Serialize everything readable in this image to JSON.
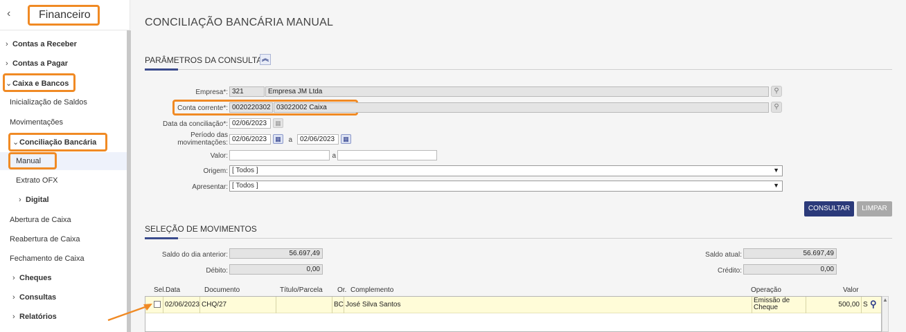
{
  "app": {
    "title": "Financeiro",
    "back_icon": "chevron-left-icon"
  },
  "sidebar": {
    "items": [
      {
        "label": "Contas a Receber"
      },
      {
        "label": "Contas a Pagar"
      },
      {
        "label": "Caixa e Bancos"
      },
      {
        "label": "Inicialização de Saldos"
      },
      {
        "label": "Movimentações"
      },
      {
        "label": "Conciliação Bancária"
      },
      {
        "label": "Manual"
      },
      {
        "label": "Extrato OFX"
      },
      {
        "label": "Digital"
      },
      {
        "label": "Abertura de Caixa"
      },
      {
        "label": "Reabertura de Caixa"
      },
      {
        "label": "Fechamento de Caixa"
      },
      {
        "label": "Cheques"
      },
      {
        "label": "Consultas"
      },
      {
        "label": "Relatórios"
      }
    ]
  },
  "page": {
    "title": "CONCILIAÇÃO BANCÁRIA MANUAL"
  },
  "params": {
    "section_title": "PARÂMETROS DA CONSULTA",
    "empresa_label": "Empresa*:",
    "empresa_code": "321",
    "empresa_name": "Empresa JM Ltda",
    "conta_label": "Conta corrente*:",
    "conta_code": "0020220302",
    "conta_name": "03022002 Caixa",
    "data_label": "Data da conciliação*:",
    "data_value": "02/06/2023",
    "periodo_label_1": "Período das",
    "periodo_label_2": "movimentações:",
    "periodo_from": "02/06/2023",
    "periodo_sep": "a",
    "periodo_to": "02/06/2023",
    "valor_label": "Valor:",
    "valor_from": "",
    "valor_sep": "a",
    "valor_to": "",
    "origem_label": "Origem:",
    "origem_value": "[ Todos ]",
    "apresentar_label": "Apresentar:",
    "apresentar_value": "[ Todos ]",
    "consultar_label": "CONSULTAR",
    "limpar_label": "LIMPAR"
  },
  "selecao": {
    "section_title": "SELEÇÃO DE MOVIMENTOS",
    "saldo_anterior_label": "Saldo do dia anterior:",
    "saldo_anterior_value": "56.697,49",
    "debito_label": "Débito:",
    "debito_value": "0,00",
    "saldo_atual_label": "Saldo atual:",
    "saldo_atual_value": "56.697,49",
    "credito_label": "Crédito:",
    "credito_value": "0,00"
  },
  "grid": {
    "headers": {
      "sel": "Sel.",
      "data": "Data",
      "documento": "Documento",
      "titulo": "Título/Parcela",
      "origem": "Or.",
      "complemento": "Complemento",
      "operacao": "Operação",
      "valor": "Valor"
    },
    "rows": [
      {
        "data": "02/06/2023",
        "documento": "CHQ/27",
        "titulo": "",
        "origem": "BC",
        "complemento": "José Silva Santos",
        "operacao_1": "Emissão de",
        "operacao_2": "Cheque",
        "valor": "500,00",
        "tipo": "S"
      }
    ]
  },
  "colors": {
    "highlight": "#f08a24",
    "primary_button": "#2b3a7a",
    "disabled_button": "#a9a9a9",
    "row_highlight": "#fffcd8"
  }
}
